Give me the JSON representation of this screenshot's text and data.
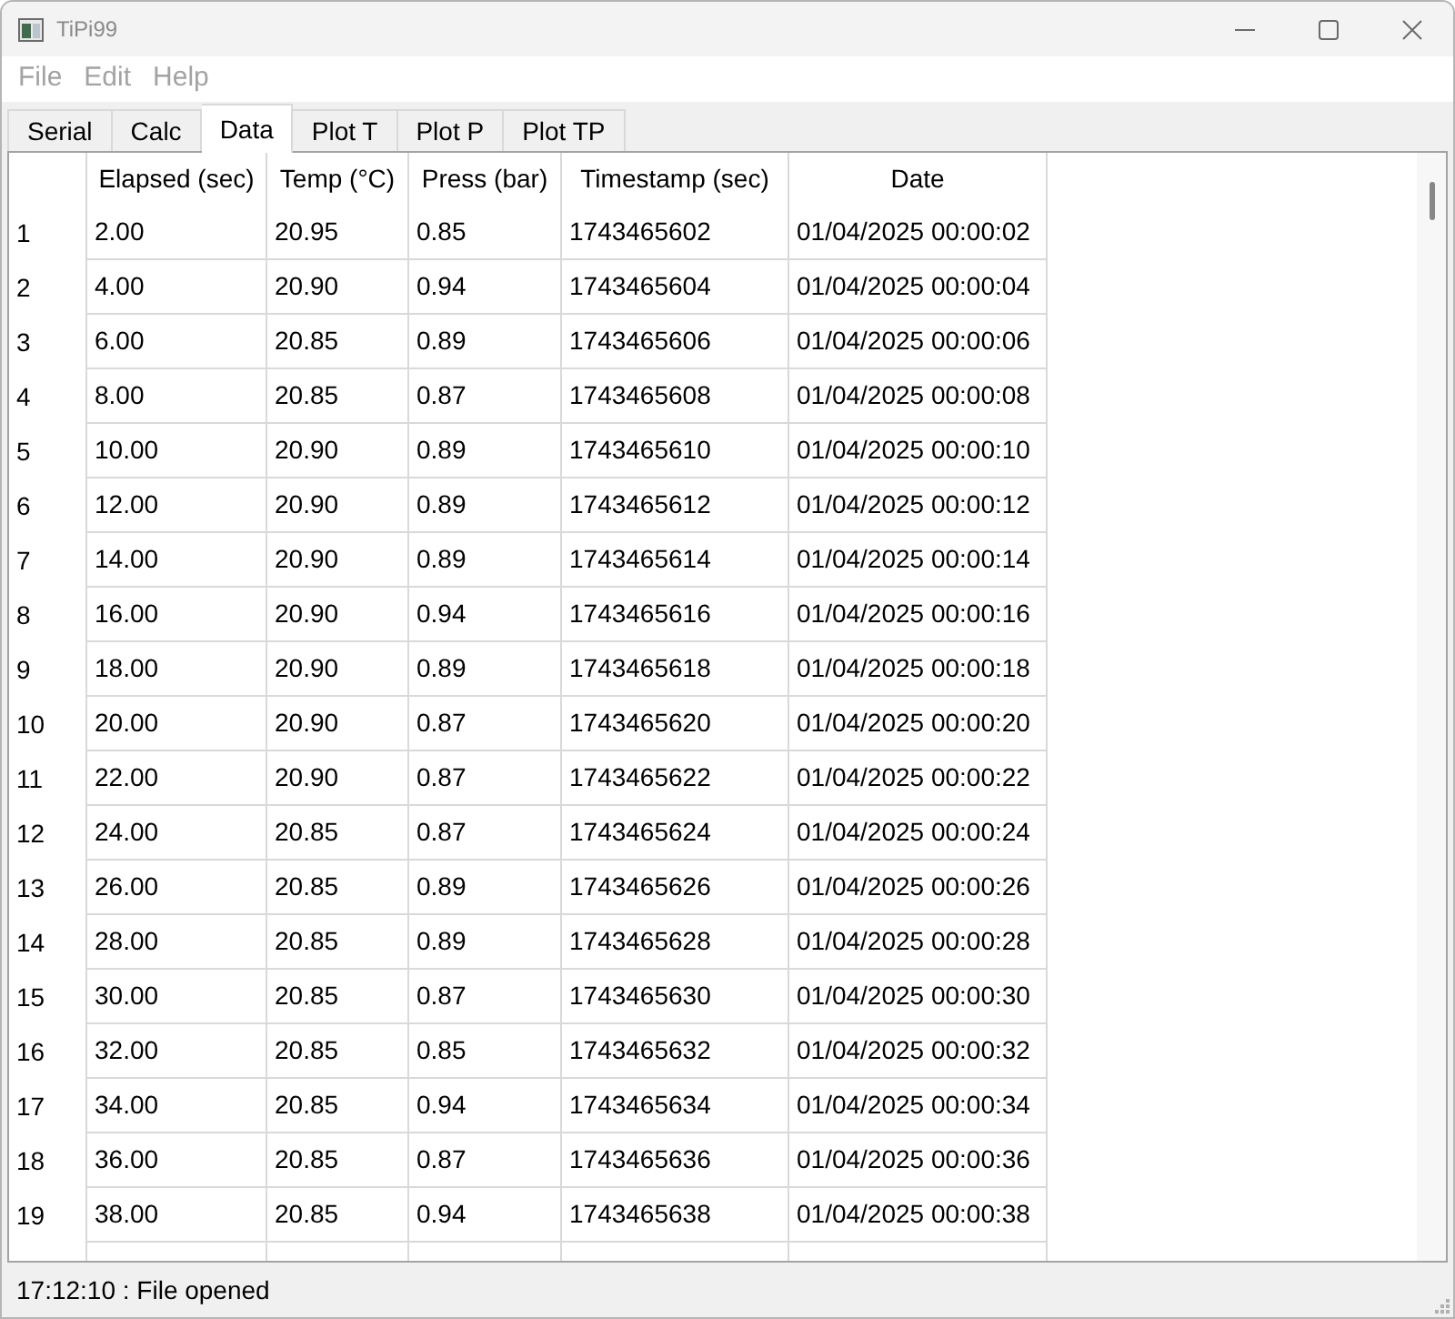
{
  "window": {
    "title": "TiPi99"
  },
  "menu": [
    {
      "label": "File",
      "disabled": true
    },
    {
      "label": "Edit",
      "disabled": true
    },
    {
      "label": "Help",
      "disabled": true
    }
  ],
  "tabs": [
    {
      "label": "Serial",
      "selected": false
    },
    {
      "label": "Calc",
      "selected": false
    },
    {
      "label": "Data",
      "selected": true
    },
    {
      "label": "Plot T",
      "selected": false
    },
    {
      "label": "Plot P",
      "selected": false
    },
    {
      "label": "Plot TP",
      "selected": false
    }
  ],
  "table": {
    "columns": [
      "Elapsed (sec)",
      "Temp (°C)",
      "Press (bar)",
      "Timestamp (sec)",
      "Date"
    ],
    "rows": [
      {
        "header": "1",
        "cells": [
          "2.00",
          "20.95",
          "0.85",
          "1743465602",
          "01/04/2025 00:00:02"
        ]
      },
      {
        "header": "2",
        "cells": [
          "4.00",
          "20.90",
          "0.94",
          "1743465604",
          "01/04/2025 00:00:04"
        ]
      },
      {
        "header": "3",
        "cells": [
          "6.00",
          "20.85",
          "0.89",
          "1743465606",
          "01/04/2025 00:00:06"
        ]
      },
      {
        "header": "4",
        "cells": [
          "8.00",
          "20.85",
          "0.87",
          "1743465608",
          "01/04/2025 00:00:08"
        ]
      },
      {
        "header": "5",
        "cells": [
          "10.00",
          "20.90",
          "0.89",
          "1743465610",
          "01/04/2025 00:00:10"
        ]
      },
      {
        "header": "6",
        "cells": [
          "12.00",
          "20.90",
          "0.89",
          "1743465612",
          "01/04/2025 00:00:12"
        ]
      },
      {
        "header": "7",
        "cells": [
          "14.00",
          "20.90",
          "0.89",
          "1743465614",
          "01/04/2025 00:00:14"
        ]
      },
      {
        "header": "8",
        "cells": [
          "16.00",
          "20.90",
          "0.94",
          "1743465616",
          "01/04/2025 00:00:16"
        ]
      },
      {
        "header": "9",
        "cells": [
          "18.00",
          "20.90",
          "0.89",
          "1743465618",
          "01/04/2025 00:00:18"
        ]
      },
      {
        "header": "10",
        "cells": [
          "20.00",
          "20.90",
          "0.87",
          "1743465620",
          "01/04/2025 00:00:20"
        ]
      },
      {
        "header": "11",
        "cells": [
          "22.00",
          "20.90",
          "0.87",
          "1743465622",
          "01/04/2025 00:00:22"
        ]
      },
      {
        "header": "12",
        "cells": [
          "24.00",
          "20.85",
          "0.87",
          "1743465624",
          "01/04/2025 00:00:24"
        ]
      },
      {
        "header": "13",
        "cells": [
          "26.00",
          "20.85",
          "0.89",
          "1743465626",
          "01/04/2025 00:00:26"
        ]
      },
      {
        "header": "14",
        "cells": [
          "28.00",
          "20.85",
          "0.89",
          "1743465628",
          "01/04/2025 00:00:28"
        ]
      },
      {
        "header": "15",
        "cells": [
          "30.00",
          "20.85",
          "0.87",
          "1743465630",
          "01/04/2025 00:00:30"
        ]
      },
      {
        "header": "16",
        "cells": [
          "32.00",
          "20.85",
          "0.85",
          "1743465632",
          "01/04/2025 00:00:32"
        ]
      },
      {
        "header": "17",
        "cells": [
          "34.00",
          "20.85",
          "0.94",
          "1743465634",
          "01/04/2025 00:00:34"
        ]
      },
      {
        "header": "18",
        "cells": [
          "36.00",
          "20.85",
          "0.87",
          "1743465636",
          "01/04/2025 00:00:36"
        ]
      },
      {
        "header": "19",
        "cells": [
          "38.00",
          "20.85",
          "0.94",
          "1743465638",
          "01/04/2025 00:00:38"
        ]
      }
    ]
  },
  "status_bar": {
    "text": "17:12:10 : File opened"
  }
}
